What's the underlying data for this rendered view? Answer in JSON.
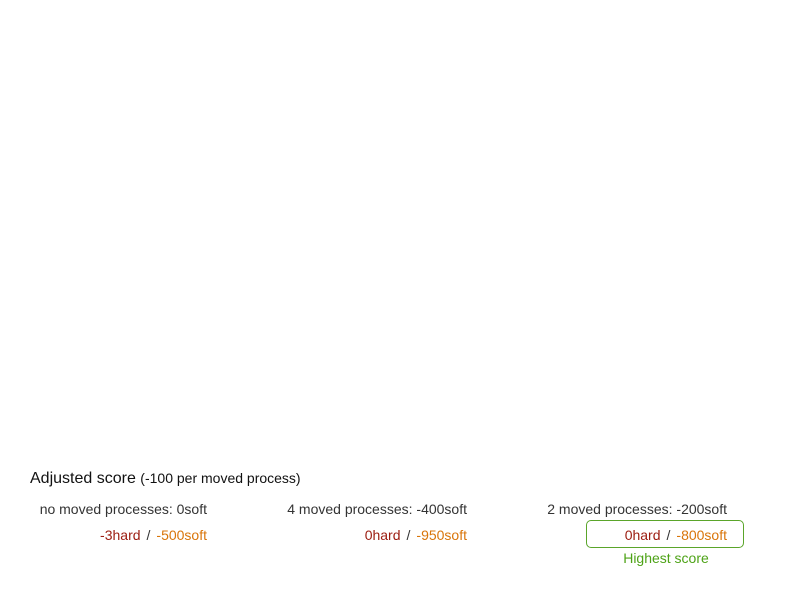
{
  "heading": {
    "title": "Adjusted score",
    "subtitle": "(-100 per moved process)"
  },
  "columns": [
    {
      "moved_label": "no moved processes: 0soft",
      "hard": "-3hard",
      "separator": "/",
      "soft": "-500soft"
    },
    {
      "moved_label": "4 moved processes: -400soft",
      "hard": "0hard",
      "separator": "/",
      "soft": "-950soft"
    },
    {
      "moved_label": "2 moved processes: -200soft",
      "hard": "0hard",
      "separator": "/",
      "soft": "-800soft"
    }
  ],
  "highlight": {
    "label": "Highest score",
    "column_index": 2
  },
  "colors": {
    "hard": "#9c1c10",
    "soft": "#d9750a",
    "highlight": "#5aa52a"
  }
}
